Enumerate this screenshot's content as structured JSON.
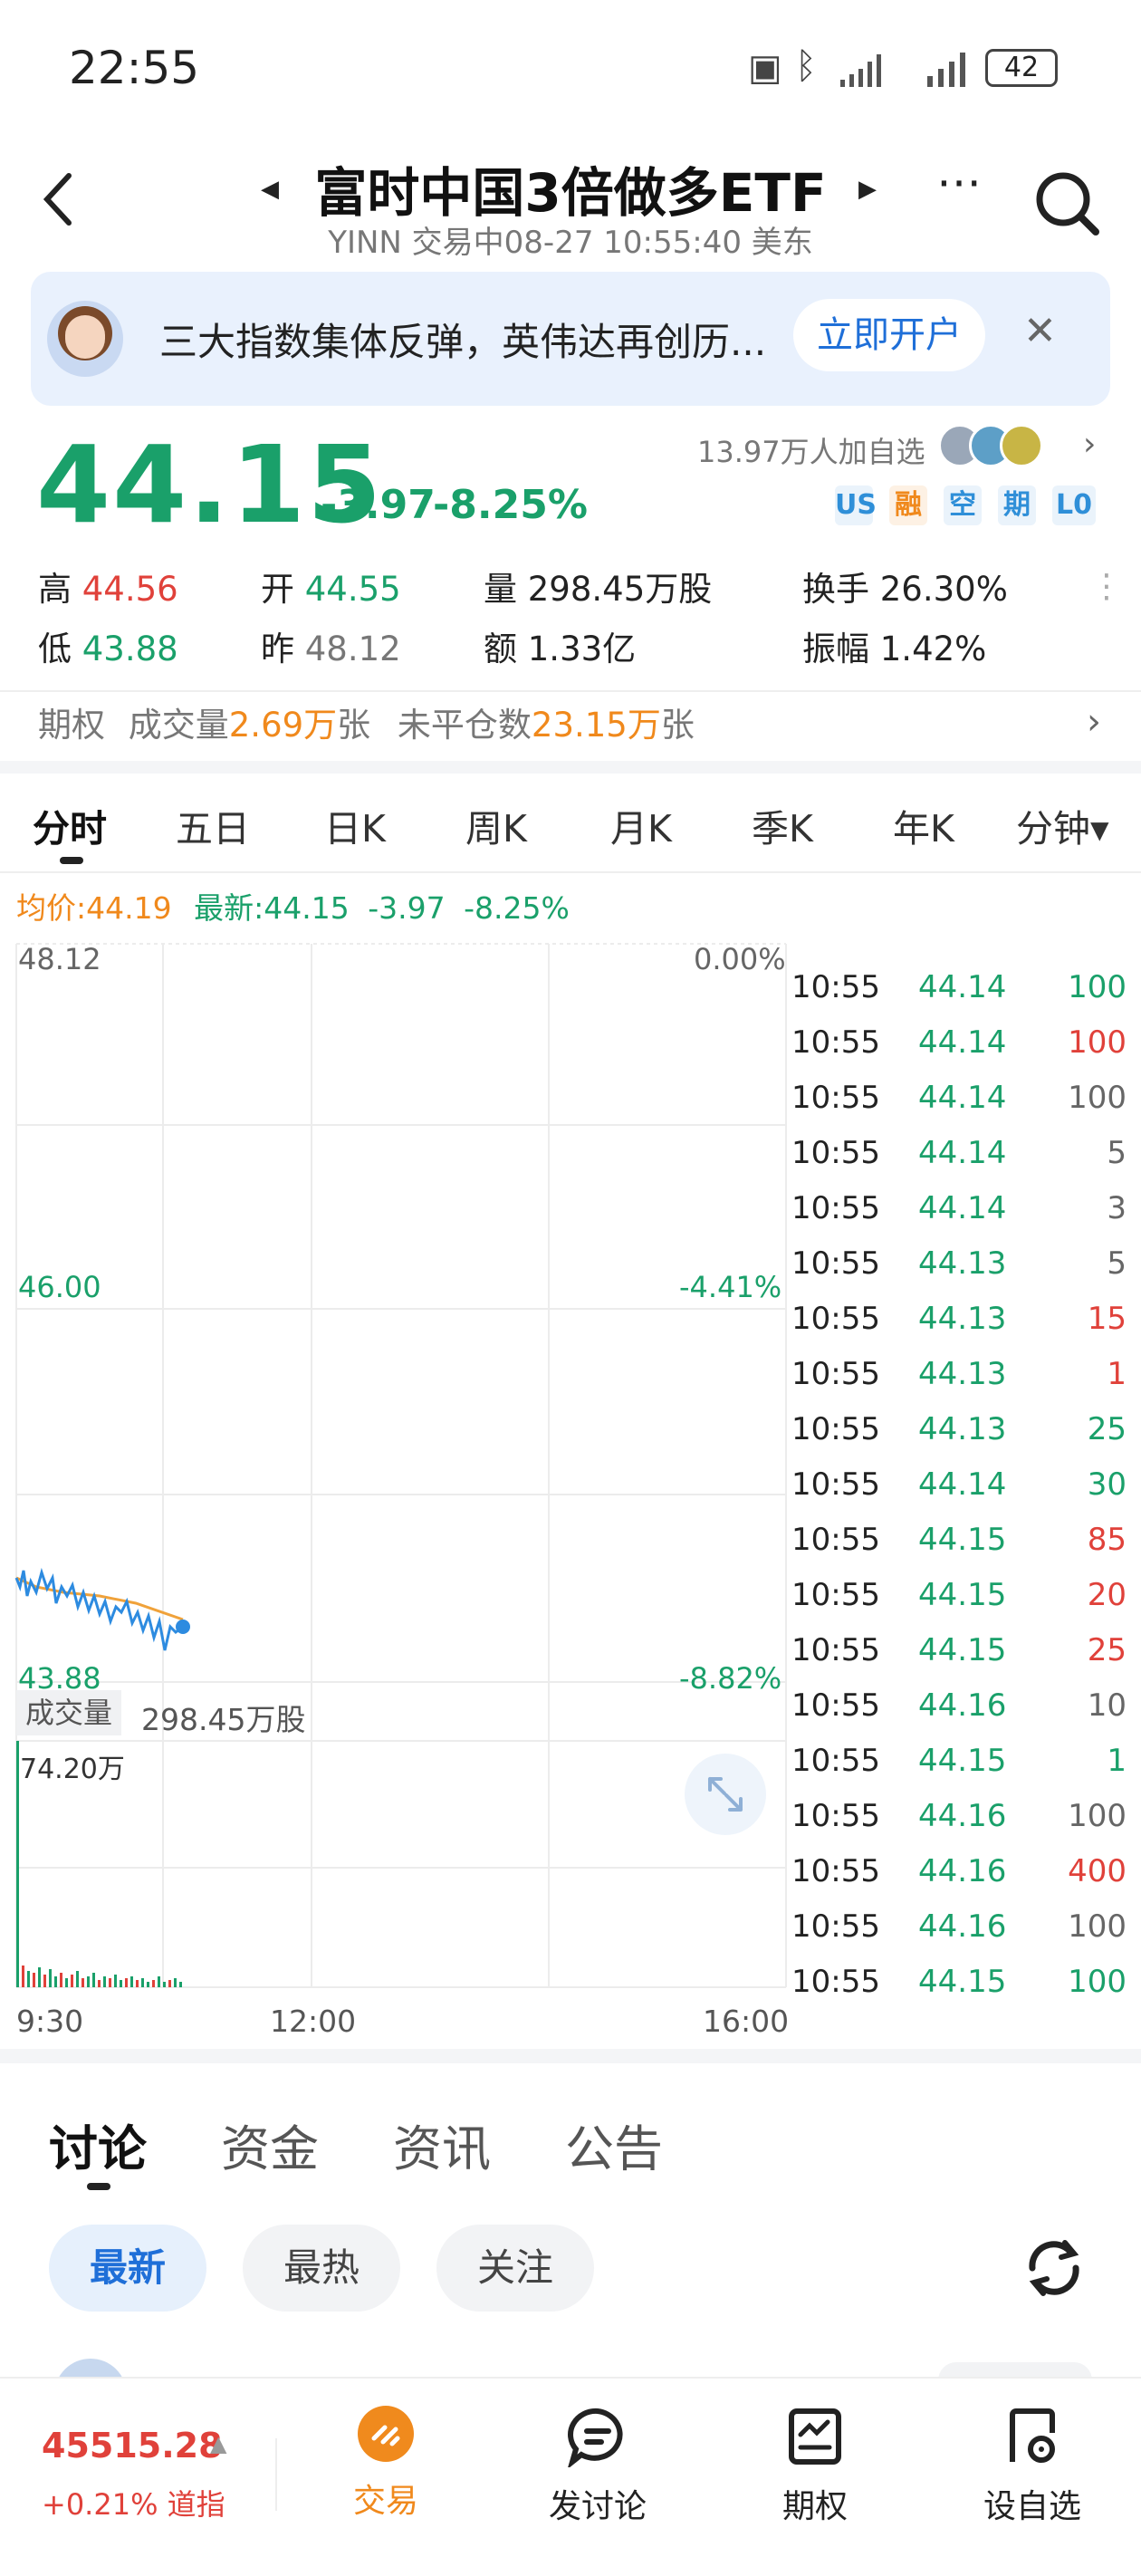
{
  "status": {
    "time": "22:55",
    "battery": "42"
  },
  "nav": {
    "title": "富时中国3倍做多ETF",
    "subtitle": "YINN 交易中08-27 10:55:40 美东"
  },
  "banner": {
    "text": "三大指数集体反弹，英伟达再创历...",
    "cta": "立即开户"
  },
  "quote": {
    "price": "44.15",
    "change": "-3.97",
    "change_pct": "-8.25%",
    "watchers": "13.97万人加自选",
    "badges": [
      "US",
      "融",
      "空",
      "期",
      "L0"
    ],
    "high_label": "高",
    "high": "44.56",
    "low_label": "低",
    "low": "43.88",
    "open_label": "开",
    "open": "44.55",
    "prev_label": "昨",
    "prev": "48.12",
    "volume_label": "量",
    "volume": "298.45万股",
    "amount_label": "额",
    "amount": "1.33亿",
    "turnover_label": "换手",
    "turnover": "26.30%",
    "amplitude_label": "振幅",
    "amplitude": "1.42%",
    "options_label": "期权",
    "opt_vol_label": "成交量",
    "opt_vol": "2.69万",
    "opt_vol_unit": "张",
    "oi_label": "未平仓数",
    "oi": "23.15万",
    "oi_unit": "张"
  },
  "tabs": [
    "分时",
    "五日",
    "日K",
    "周K",
    "月K",
    "季K",
    "年K",
    "分钟▾"
  ],
  "chart": {
    "avg_label": "均价:44.19",
    "latest_label": "最新:44.15",
    "latest_chg": "-3.97",
    "latest_pct": "-8.25%",
    "y_top": "48.12",
    "y_mid": "46.00",
    "y_low": "43.88",
    "pct_top": "0.00%",
    "pct_mid": "-4.41%",
    "pct_low": "-8.82%",
    "volume_tag": "成交量",
    "volume_value": "298.45万股",
    "vol_max": "74.20万",
    "x_start": "9:30",
    "x_mid": "12:00",
    "x_end": "16:00"
  },
  "trades": [
    {
      "t": "10:55",
      "p": "44.14",
      "v": "100",
      "c": "green"
    },
    {
      "t": "10:55",
      "p": "44.14",
      "v": "100",
      "c": "red"
    },
    {
      "t": "10:55",
      "p": "44.14",
      "v": "100",
      "c": "grey"
    },
    {
      "t": "10:55",
      "p": "44.14",
      "v": "5",
      "c": "grey"
    },
    {
      "t": "10:55",
      "p": "44.14",
      "v": "3",
      "c": "grey"
    },
    {
      "t": "10:55",
      "p": "44.13",
      "v": "5",
      "c": "grey"
    },
    {
      "t": "10:55",
      "p": "44.13",
      "v": "15",
      "c": "red"
    },
    {
      "t": "10:55",
      "p": "44.13",
      "v": "1",
      "c": "red"
    },
    {
      "t": "10:55",
      "p": "44.13",
      "v": "25",
      "c": "green"
    },
    {
      "t": "10:55",
      "p": "44.14",
      "v": "30",
      "c": "green"
    },
    {
      "t": "10:55",
      "p": "44.15",
      "v": "85",
      "c": "red"
    },
    {
      "t": "10:55",
      "p": "44.15",
      "v": "20",
      "c": "red"
    },
    {
      "t": "10:55",
      "p": "44.15",
      "v": "25",
      "c": "red"
    },
    {
      "t": "10:55",
      "p": "44.16",
      "v": "10",
      "c": "grey"
    },
    {
      "t": "10:55",
      "p": "44.15",
      "v": "1",
      "c": "green"
    },
    {
      "t": "10:55",
      "p": "44.16",
      "v": "100",
      "c": "grey"
    },
    {
      "t": "10:55",
      "p": "44.16",
      "v": "400",
      "c": "red"
    },
    {
      "t": "10:55",
      "p": "44.16",
      "v": "100",
      "c": "grey"
    },
    {
      "t": "10:55",
      "p": "44.15",
      "v": "100",
      "c": "green"
    }
  ],
  "sections": [
    "讨论",
    "资金",
    "资讯",
    "公告"
  ],
  "filters": [
    "最新",
    "最热",
    "关注"
  ],
  "tabbar": {
    "index_value": "45515.28",
    "index_change": "+0.21% 道指",
    "trade": "交易",
    "post": "发讨论",
    "options": "期权",
    "watch": "设自选"
  },
  "colors": {
    "up": "#e0413a",
    "down": "#1aa06a",
    "accent": "#1f6fd8",
    "orange": "#f0891c"
  }
}
